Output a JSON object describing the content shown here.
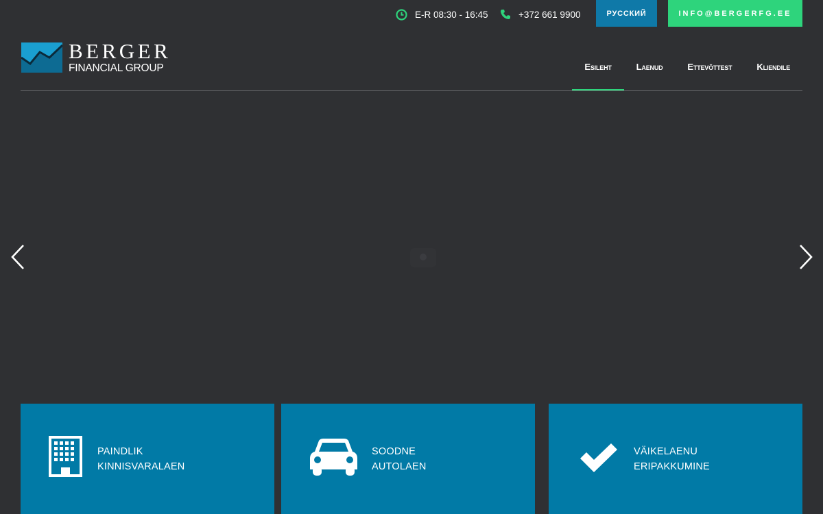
{
  "topbar": {
    "hours_icon": "clock-icon",
    "hours": "E-R 08:30 - 16:45",
    "phone_icon": "phone-icon",
    "phone": "+372 661 9900",
    "language_button": "РУССКИЙ",
    "email_button": "INFO@BERGERFG.EE"
  },
  "header": {
    "logo": {
      "name": "BERGER",
      "subtitle": "FINANCIAL GROUP"
    },
    "nav": [
      {
        "label": "Esileht",
        "active": true
      },
      {
        "label": "Laenud",
        "active": false
      },
      {
        "label": "Ettevõttest",
        "active": false
      },
      {
        "label": "Kliendile",
        "active": false
      }
    ]
  },
  "slider": {
    "prev_icon": "chevron-left-icon",
    "next_icon": "chevron-right-icon",
    "loading_icon": "spinner-icon"
  },
  "tiles": [
    {
      "icon": "building-icon",
      "line1": "PAINDLIK",
      "line2": "KINNISVARALAEN"
    },
    {
      "icon": "car-icon",
      "line1": "SOODNE",
      "line2": "AUTOLAEN"
    },
    {
      "icon": "checkmark-icon",
      "line1": "VÄIKELAENU",
      "line2": "ERIPAKKUMINE"
    }
  ],
  "colors": {
    "background": "#2f3033",
    "accent_green": "#2ed47c",
    "accent_blue": "#017aa6",
    "button_blue": "#0f79a8"
  }
}
